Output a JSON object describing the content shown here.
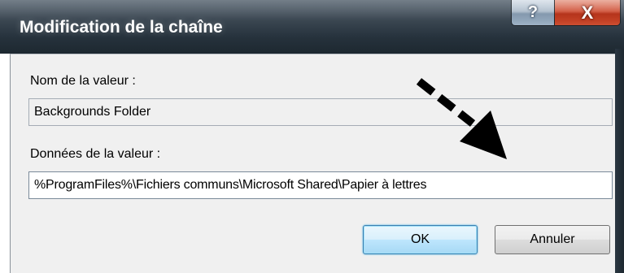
{
  "window": {
    "title": "Modification de la chaîne",
    "help_label": "?",
    "close_label": "X"
  },
  "form": {
    "name_label": "Nom de la valeur :",
    "name_value": "Backgrounds Folder",
    "data_label": "Données de la valeur :",
    "data_value": "%ProgramFiles%\\Fichiers communs\\Microsoft Shared\\Papier à lettres"
  },
  "buttons": {
    "ok_label": "OK",
    "cancel_label": "Annuler"
  },
  "annotation": {
    "arrow_icon": "dashed-arrow-pointing-down-right",
    "arrow_color": "#000000"
  }
}
